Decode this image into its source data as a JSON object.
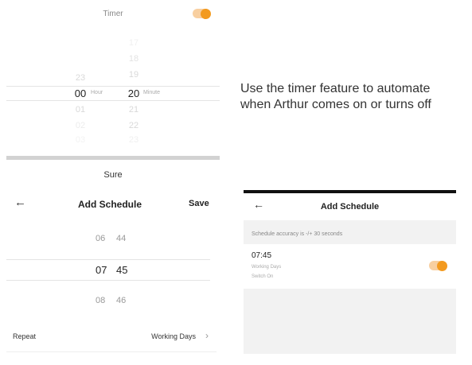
{
  "timer_panel": {
    "title": "Timer",
    "toggle_on": true,
    "accent_color": "#f39a1f",
    "hour_column": [
      "23",
      "00",
      "01",
      "02",
      "03"
    ],
    "hour_selected": "00",
    "hour_unit": "Hour",
    "minute_column": [
      "17",
      "18",
      "19",
      "20",
      "21",
      "22",
      "23"
    ],
    "minute_selected": "20",
    "minute_unit": "Minute"
  },
  "caption": {
    "line1": "Use the timer feature to automate",
    "line2": "when Arthur comes on or turns off"
  },
  "sure_label": "Sure",
  "schedule_left": {
    "back_icon": "arrow-left-icon",
    "title": "Add Schedule",
    "save_label": "Save",
    "rows": [
      {
        "hour": "06",
        "minute": "44"
      },
      {
        "hour": "07",
        "minute": "45"
      },
      {
        "hour": "08",
        "minute": "46"
      }
    ],
    "repeat_label": "Repeat",
    "repeat_value": "Working Days"
  },
  "schedule_right": {
    "back_icon": "arrow-left-icon",
    "title": "Add Schedule",
    "note": "Schedule accuracy is -/+ 30 seconds",
    "item_time": "07:45",
    "item_days": "Working Days",
    "item_action": "Switch On",
    "toggle_on": true
  }
}
